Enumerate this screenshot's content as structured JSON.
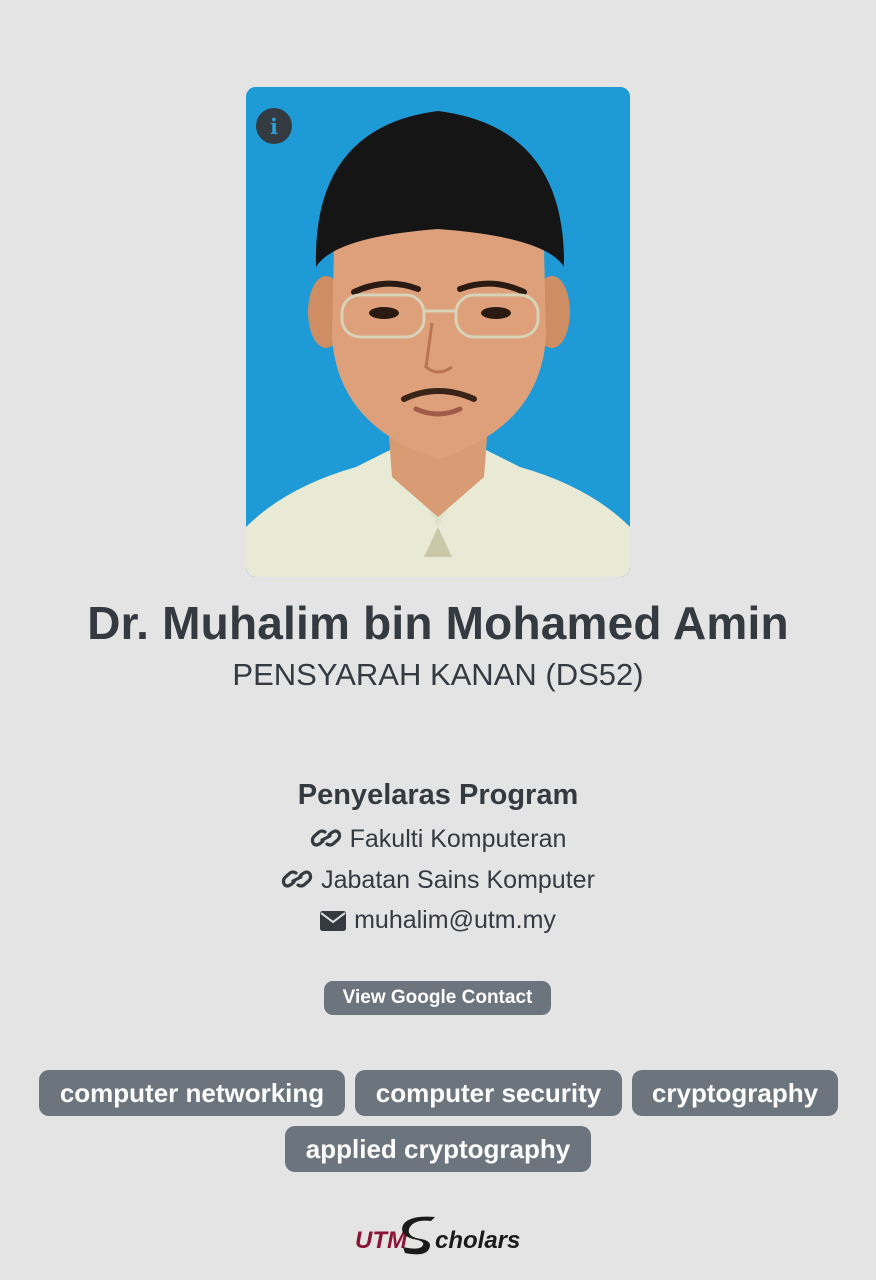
{
  "profile": {
    "photo_alt": "Profile photo",
    "name": "Dr. Muhalim bin Mohamed Amin",
    "position": "PENSYARAH KANAN (DS52)",
    "role": "Penyelaras Program",
    "faculty": "Fakulti Komputeran",
    "department": "Jabatan Sains Komputer",
    "email": "muhalim@utm.my"
  },
  "actions": {
    "view_contact_label": "View Google Contact"
  },
  "tags": [
    "computer networking",
    "computer security",
    "cryptography",
    "applied cryptography"
  ],
  "footer": {
    "logo_text_utm": "UTM",
    "logo_text_scholars": "cholars"
  },
  "colors": {
    "background": "#e4e4e5",
    "text": "#343a40",
    "badge": "#6c757d",
    "photo_backdrop": "#1e9bd7",
    "logo_utm": "#8b1538"
  },
  "icons": {
    "info": "info-icon",
    "faculty": "link-icon",
    "department": "link-icon",
    "email": "envelope-icon"
  }
}
